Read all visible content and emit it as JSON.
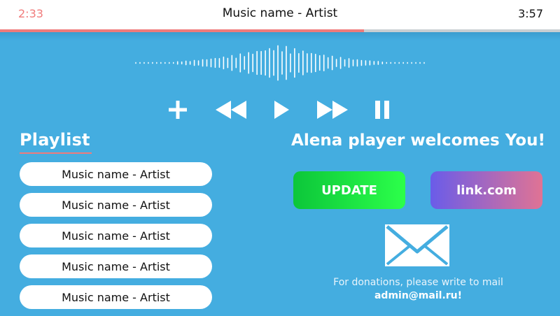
{
  "header": {
    "elapsed": "2:33",
    "track": "Music name - Artist",
    "duration": "3:57",
    "progress_fraction": 0.65,
    "progress_color": "#f07b7b"
  },
  "controls": {
    "add_icon": "plus-icon",
    "rewind_icon": "rewind-icon",
    "play_icon": "play-icon",
    "forward_icon": "fast-forward-icon",
    "pause_icon": "pause-icon"
  },
  "playlist": {
    "title": "Playlist",
    "items": [
      "Music name - Artist",
      "Music name - Artist",
      "Music name - Artist",
      "Music name - Artist",
      "Music name - Artist"
    ]
  },
  "welcome": "Alena player welcomes You!",
  "buttons": {
    "update": "UPDATE",
    "link": "link.com"
  },
  "donation": {
    "icon": "mail-icon",
    "text": "For donations, please write to mail",
    "email": "admin@mail.ru!"
  },
  "colors": {
    "background": "#44ade0",
    "accent": "#f07b7b",
    "update_gradient": [
      "#0cc63a",
      "#2cff4a"
    ],
    "link_gradient": [
      "#6a5ce9",
      "#e07394"
    ]
  }
}
